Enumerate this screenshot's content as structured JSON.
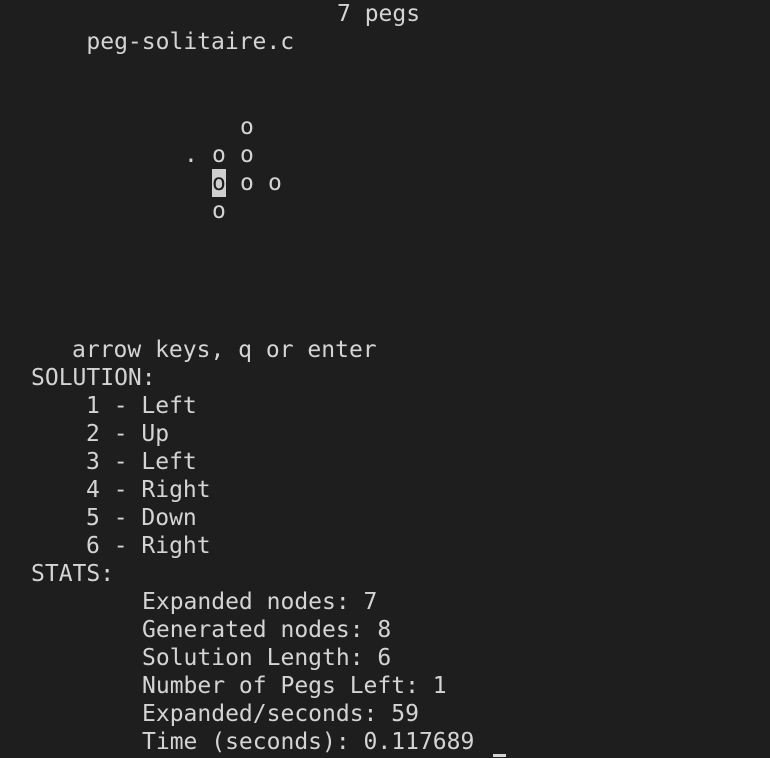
{
  "header": {
    "filename": "peg-solitaire.c",
    "peg_count": "7 pegs"
  },
  "board": {
    "peg_char": "o",
    "empty_char": "."
  },
  "instructions": "arrow keys, q or enter",
  "solution": {
    "label": "SOLUTION:",
    "moves": [
      "1 - Left",
      "2 - Up",
      "3 - Left",
      "4 - Right",
      "5 - Down",
      "6 - Right"
    ]
  },
  "stats": {
    "label": "STATS:",
    "lines": [
      "Expanded nodes: 7",
      "Generated nodes: 8",
      "Solution Length: 6",
      "Number of Pegs Left: 1",
      "Expanded/seconds: 59",
      "Time (seconds): 0.117689"
    ]
  },
  "colors": {
    "background": "#1e1e1e",
    "foreground": "#d4d4d4",
    "selection": "#cfcfcf"
  }
}
